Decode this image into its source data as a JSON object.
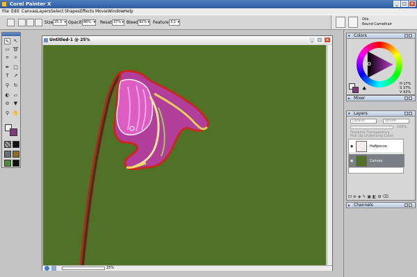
{
  "app": {
    "title": "Corel Painter X"
  },
  "menu": [
    "File",
    "Edit",
    "Canvas",
    "Layers",
    "Select",
    "Shapes",
    "Effects",
    "Movie",
    "Window",
    "Help"
  ],
  "property_bar": {
    "size_label": "Size:",
    "size_value": "25.3",
    "opacity_label": "Opacity:",
    "opacity_value": "86%",
    "resat_label": "Resat:",
    "resat_value": "37%",
    "bleed_label": "Bleed:",
    "bleed_value": "92%",
    "feature_label": "Feature:",
    "feature_value": "3.2"
  },
  "brush_selector": {
    "category": "Oils",
    "variant": "Round Camelhair"
  },
  "document": {
    "title": "Untitled-1 @ 25%",
    "zoom": "25%",
    "canvas_color": "#4f7226"
  },
  "colors_panel": {
    "title": "Colors",
    "readout": [
      "H 17%",
      "S 37%",
      "V 42%"
    ],
    "main_color": "#f2f2f2",
    "additional_color": "#7a3d7a"
  },
  "mixer_panel": {
    "title": "Mixer"
  },
  "layers_panel": {
    "title": "Layers",
    "composite_method": "Default",
    "composite_depth": "Ignore",
    "opacity_value": "100%",
    "preserve_transparency": "Preserve Transparency",
    "pick_underlying": "Pick Up Underlying Color",
    "layers": [
      {
        "name": "Набросок",
        "selected": false
      },
      {
        "name": "Canvas",
        "selected": true
      }
    ]
  },
  "channels_panel": {
    "title": "Channels"
  }
}
